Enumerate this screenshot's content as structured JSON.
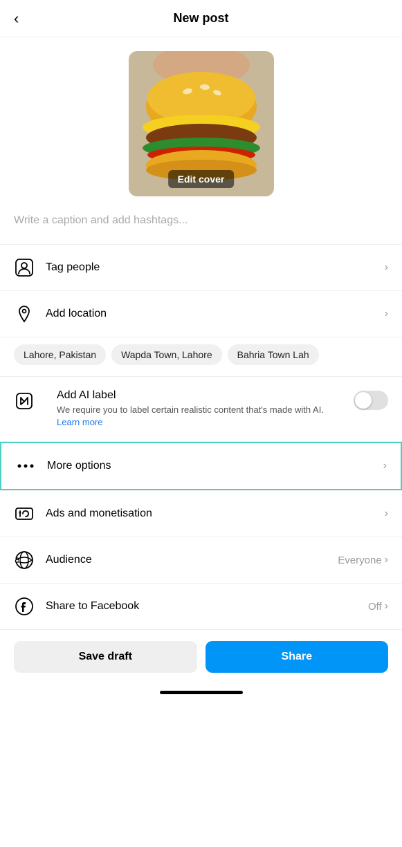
{
  "header": {
    "title": "New post",
    "back_label": "‹"
  },
  "cover": {
    "edit_label": "Edit cover"
  },
  "caption": {
    "placeholder": "Write a caption and add hashtags..."
  },
  "menu": {
    "tag_people": "Tag people",
    "add_location": "Add location",
    "add_ai_label": "Add AI label",
    "ai_description": "We require you to label certain realistic content that's made with AI.",
    "ai_learn_more": "Learn more",
    "more_options": "More options",
    "ads_monetisation": "Ads and monetisation",
    "audience": "Audience",
    "audience_value": "Everyone",
    "share_facebook": "Share to Facebook",
    "share_facebook_value": "Off"
  },
  "location_chips": [
    "Lahore, Pakistan",
    "Wapda Town, Lahore",
    "Bahria Town Lah"
  ],
  "buttons": {
    "save_draft": "Save draft",
    "share": "Share"
  },
  "colors": {
    "accent_teal": "#4dd0c4",
    "link_blue": "#1877F2",
    "share_blue": "#0095f6"
  }
}
